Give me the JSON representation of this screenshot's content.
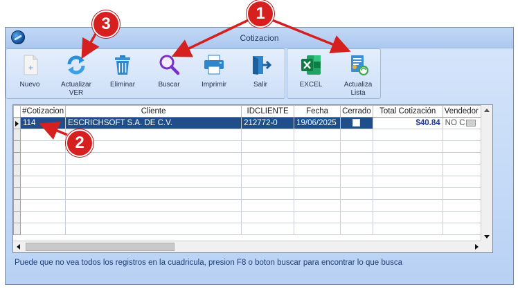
{
  "window": {
    "title": "Cotizacion"
  },
  "toolbar": {
    "buttons": [
      {
        "label": "Nuevo",
        "icon": "document-plus-icon"
      },
      {
        "label": "Actualizar VER",
        "icon": "refresh-icon"
      },
      {
        "label": "Eliminar",
        "icon": "trash-icon"
      },
      {
        "label": "Buscar",
        "icon": "search-icon"
      },
      {
        "label": "Imprimir",
        "icon": "printer-icon"
      },
      {
        "label": "Salir",
        "icon": "exit-icon"
      }
    ],
    "buttons_right": [
      {
        "label": "EXCEL",
        "icon": "excel-icon"
      },
      {
        "label": "Actualiza Lista",
        "icon": "update-list-icon"
      }
    ]
  },
  "grid": {
    "columns": [
      "#Cotizacion",
      "Cliente",
      "IDCLIENTE",
      "Fecha",
      "Cerrado",
      "Total Cotización",
      "Vendedor"
    ],
    "rows": [
      {
        "cotizacion": "114",
        "cliente": "ESCRICHSOFT S.A. DE C.V.",
        "idcliente": "212772-0",
        "fecha": "19/06/2025",
        "cerrado": false,
        "total": "$40.84",
        "vendedor": "NO C"
      }
    ]
  },
  "hint": "Puede que no vea todos los registros en la cuadricula, presion F8 o boton buscar para encontrar lo que busca",
  "callouts": [
    "1",
    "2",
    "3"
  ],
  "colors": {
    "selection": "#1e4f8a",
    "callout": "#d61f1f",
    "window_bg": "#c6dbf7"
  }
}
